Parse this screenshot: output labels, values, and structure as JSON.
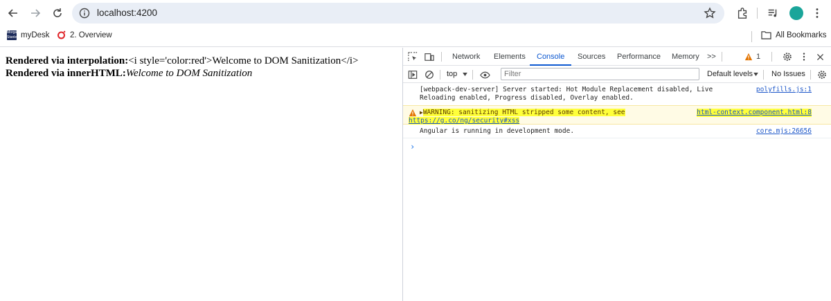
{
  "browser": {
    "url": "localhost:4200",
    "bookmarks": [
      {
        "label": "myDesk",
        "icon": "morgan-stanley-favicon"
      },
      {
        "label": "2. Overview",
        "icon": "oracle-o-icon"
      }
    ],
    "all_bookmarks": "All Bookmarks",
    "favicon_text": "Morgan Stanley"
  },
  "page": {
    "line1_label": "Rendered via interpolation:",
    "line1_value": "<i style='color:red'>Welcome to DOM Sanitization</i>",
    "line2_label": "Rendered via innerHTML:",
    "line2_value": "Welcome to DOM Sanitization"
  },
  "devtools": {
    "tabs": [
      "Network",
      "Elements",
      "Console",
      "Sources",
      "Performance",
      "Memory"
    ],
    "active_tab": "Console",
    "more_tabs": ">>",
    "warning_count": "1",
    "context": "top",
    "filter_placeholder": "Filter",
    "levels": "Default levels",
    "issues": "No Issues",
    "messages": [
      {
        "type": "info",
        "text_line1": "[webpack-dev-server] Server started: Hot Module Replacement disabled, Live",
        "text_line2": "Reloading enabled, Progress disabled, Overlay enabled.",
        "source": "polyfills.js:1"
      },
      {
        "type": "warning",
        "text_line1": "WARNING: sanitizing HTML stripped some content, see",
        "link": "https://g.co/ng/security#xss",
        "source": "html-context.component.html:8"
      },
      {
        "type": "info",
        "text_line1": "Angular is running in development mode.",
        "source": "core.mjs:26656"
      }
    ],
    "prompt": "›"
  },
  "colors": {
    "accent": "#0b57d0",
    "highlight": "#ffff3a",
    "warning_bg": "#fffbe5",
    "avatar": "#1aa59a"
  }
}
